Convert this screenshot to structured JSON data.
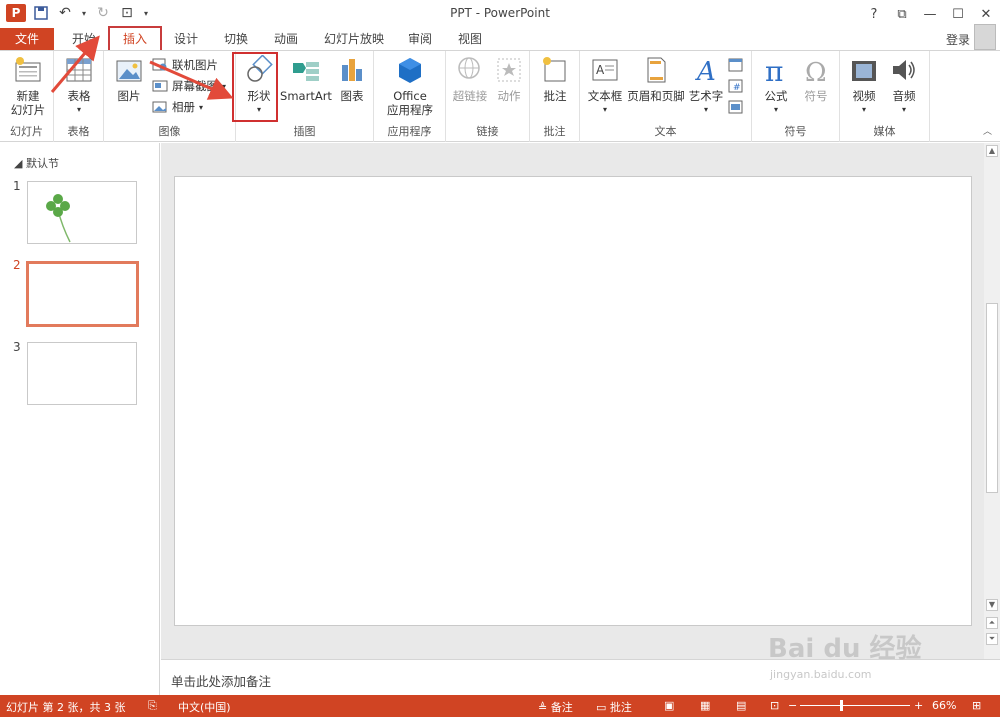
{
  "window": {
    "title": "PPT - PowerPoint",
    "app_icon_label": "P",
    "controls": [
      "?",
      "⧉",
      "—",
      "☐",
      "✕"
    ]
  },
  "tabs": {
    "file": "文件",
    "home": "开始",
    "insert": "插入",
    "design": "设计",
    "transitions": "切换",
    "animations": "动画",
    "slideshow": "幻灯片放映",
    "review": "审阅",
    "view": "视图",
    "login": "登录"
  },
  "ribbon": {
    "slides": {
      "new_slide_1": "新建",
      "new_slide_2": "幻灯片",
      "group": "幻灯片"
    },
    "tables": {
      "table": "表格",
      "group": "表格"
    },
    "images": {
      "picture": "图片",
      "online": "联机图片",
      "screenshot": "屏幕截图",
      "album": "相册",
      "group": "图像"
    },
    "illustrations": {
      "shapes": "形状",
      "smartart": "SmartArt",
      "chart": "图表",
      "group": "插图"
    },
    "apps": {
      "office_1": "Office",
      "office_2": "应用程序",
      "group": "应用程序"
    },
    "links": {
      "hyperlink": "超链接",
      "action": "动作",
      "group": "链接"
    },
    "comments": {
      "comment": "批注",
      "group": "批注"
    },
    "text": {
      "textbox": "文本框",
      "header_footer": "页眉和页脚",
      "wordart": "艺术字",
      "group": "文本"
    },
    "symbols": {
      "equation": "公式",
      "symbol": "符号",
      "group": "符号"
    },
    "media": {
      "video": "视频",
      "audio": "音频",
      "group": "媒体"
    }
  },
  "left_pane": {
    "section": "默认节",
    "slides": [
      "1",
      "2",
      "3"
    ]
  },
  "notes": {
    "placeholder": "单击此处添加备注"
  },
  "status": {
    "slide_info": "幻灯片 第 2 张，共 3 张",
    "language": "中文(中国)",
    "notes": "备注",
    "comments": "批注",
    "zoom": "66%"
  },
  "watermark": {
    "text": "Bai du 经验",
    "url": "jingyan.baidu.com"
  },
  "colors": {
    "accent": "#d04423",
    "highlight": "#d03030"
  }
}
